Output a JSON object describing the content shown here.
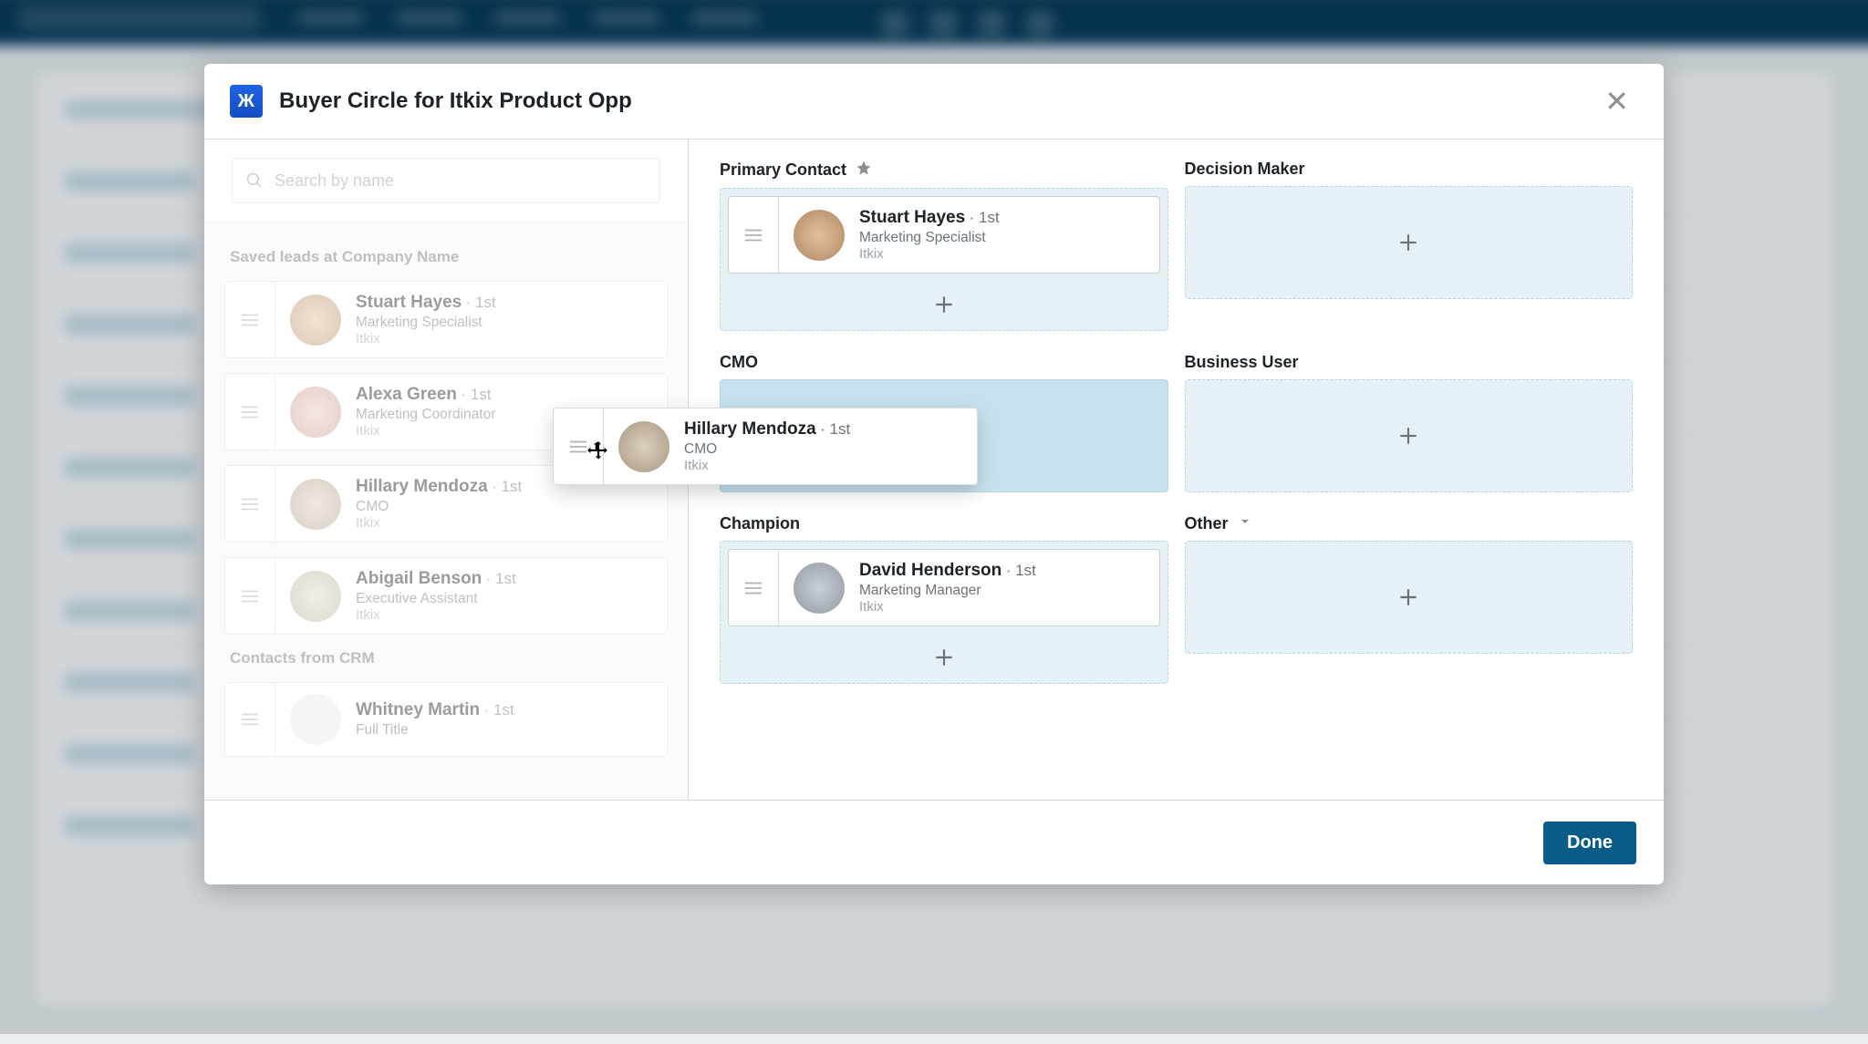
{
  "modal": {
    "brand_initial": "Ж",
    "title": "Buyer Circle for Itkix Product Opp",
    "done_label": "Done"
  },
  "search": {
    "placeholder": "Search by name",
    "value": ""
  },
  "left": {
    "section_saved": "Saved leads at Company Name",
    "section_crm": "Contacts from CRM",
    "saved_leads": [
      {
        "name": "Stuart Hayes",
        "degree": "1st",
        "title": "Marketing Specialist",
        "company": "Itkix",
        "avatar": "av-a"
      },
      {
        "name": "Alexa Green",
        "degree": "1st",
        "title": "Marketing Coordinator",
        "company": "Itkix",
        "avatar": "av-b"
      },
      {
        "name": "Hillary Mendoza",
        "degree": "1st",
        "title": "CMO",
        "company": "Itkix",
        "avatar": "av-c"
      },
      {
        "name": "Abigail Benson",
        "degree": "1st",
        "title": "Executive Assistant",
        "company": "Itkix",
        "avatar": "av-d"
      }
    ],
    "crm_leads": [
      {
        "name": "Whitney Martin",
        "degree": "1st",
        "title": "Full Title",
        "company": "",
        "avatar": "av-f"
      }
    ]
  },
  "slots": {
    "primary_contact": {
      "label": "Primary Contact"
    },
    "decision_maker": {
      "label": "Decision Maker"
    },
    "cmo": {
      "label": "CMO"
    },
    "business_user": {
      "label": "Business User"
    },
    "champion": {
      "label": "Champion"
    },
    "other": {
      "label": "Other"
    }
  },
  "assigned": {
    "primary_contact": {
      "name": "Stuart Hayes",
      "degree": "1st",
      "title": "Marketing Specialist",
      "company": "Itkix",
      "avatar": "av-a"
    },
    "champion": {
      "name": "David Henderson",
      "degree": "1st",
      "title": "Marketing Manager",
      "company": "Itkix",
      "avatar": "av-e"
    }
  },
  "dragging": {
    "name": "Hillary Mendoza",
    "degree": "1st",
    "title": "CMO",
    "company": "Itkix",
    "avatar": "av-c"
  }
}
